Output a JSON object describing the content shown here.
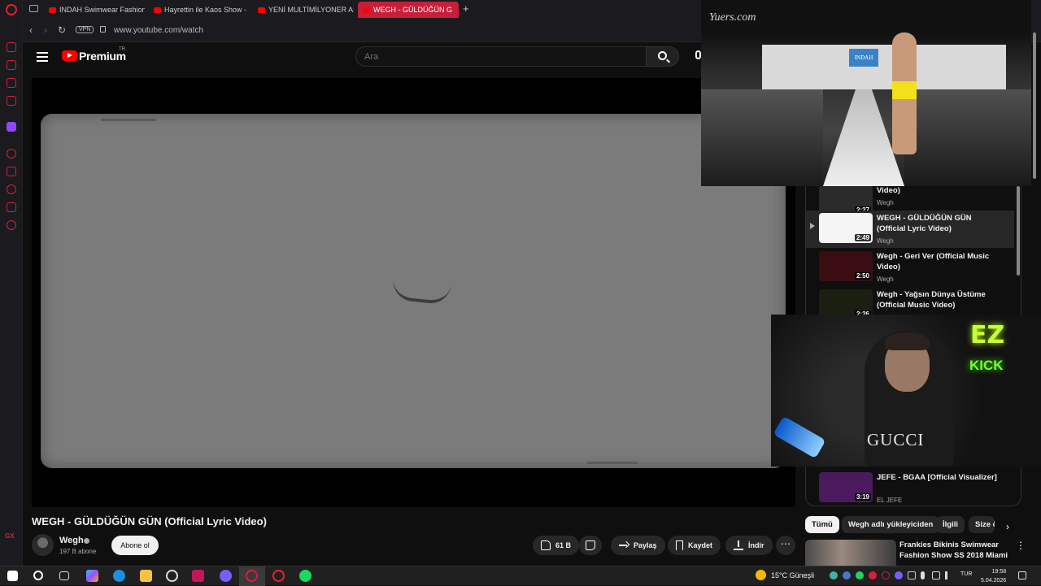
{
  "browser": {
    "tabs": [
      {
        "label": "INDAH Swimwear Fashion"
      },
      {
        "label": "Hayrettin ile Kaos Show -"
      },
      {
        "label": "YENİ MULTİMİLYONER AR"
      },
      {
        "label": "WEGH - GÜLDÜĞÜN G"
      }
    ],
    "vpn_label": "VPN",
    "url": "www.youtube.com/watch"
  },
  "opera_sidebar": {
    "bottom_label": "GX"
  },
  "youtube": {
    "logo_text": "Premium",
    "region": "TR",
    "search_placeholder": "Ara"
  },
  "fashion_overlay": {
    "watermark": "Yuers.com",
    "sign": "INDAH"
  },
  "webcam_overlay": {
    "neon_top": "EZ",
    "neon_bottom": "KICK",
    "shirt_text": "GUCCI"
  },
  "video": {
    "title": "WEGH - GÜLDÜĞÜN GÜN (Official Lyric Video)",
    "channel": "Wegh",
    "subscribers": "197 B abone",
    "subscribe_label": "Abone ol",
    "likes": "61 B",
    "share_label": "Paylaş",
    "save_label": "Kaydet",
    "download_label": "İndir",
    "more_label": "⋯"
  },
  "playlist": {
    "items": [
      {
        "title": "Video)",
        "channel": "Wegh",
        "duration": "2:27",
        "thumb_color": "#2b2b2b",
        "active": false
      },
      {
        "title": "WEGH - GÜLDÜĞÜN GÜN (Official Lyric Video)",
        "channel": "Wegh",
        "duration": "2:49",
        "thumb_color": "#f5f5f5",
        "active": true
      },
      {
        "title": "Wegh - Geri Ver (Official Music Video)",
        "channel": "Wegh",
        "duration": "2:50",
        "thumb_color": "#3a0d12",
        "active": false
      },
      {
        "title": "Wegh - Yağsın Dünya Üstüme (Official Music Video)",
        "channel": "",
        "duration": "2:26",
        "thumb_color": "#1a1f12",
        "active": false
      },
      {
        "title": "JEFE - BGAA [Official Visualizer]",
        "channel": "EL JEFE",
        "duration": "3:19",
        "thumb_color": "#4a1a5c",
        "active": false
      }
    ]
  },
  "chips": [
    {
      "label": "Tümü",
      "active": true
    },
    {
      "label": "Wegh adlı yükleyiciden",
      "active": false
    },
    {
      "label": "İlgili",
      "active": false
    },
    {
      "label": "Size ö",
      "active": false
    }
  ],
  "recommendation": {
    "title": "Frankies Bikinis Swimwear Fashion Show SS 2018 Miami ..."
  },
  "taskbar": {
    "weather": "15°C  Güneşli",
    "language": "TUR",
    "time": "19:58",
    "date": "5.04.2026"
  },
  "colors": {
    "opera_red": "#d81f3c",
    "youtube_red": "#ff0000",
    "background": "#0f0f0f"
  }
}
